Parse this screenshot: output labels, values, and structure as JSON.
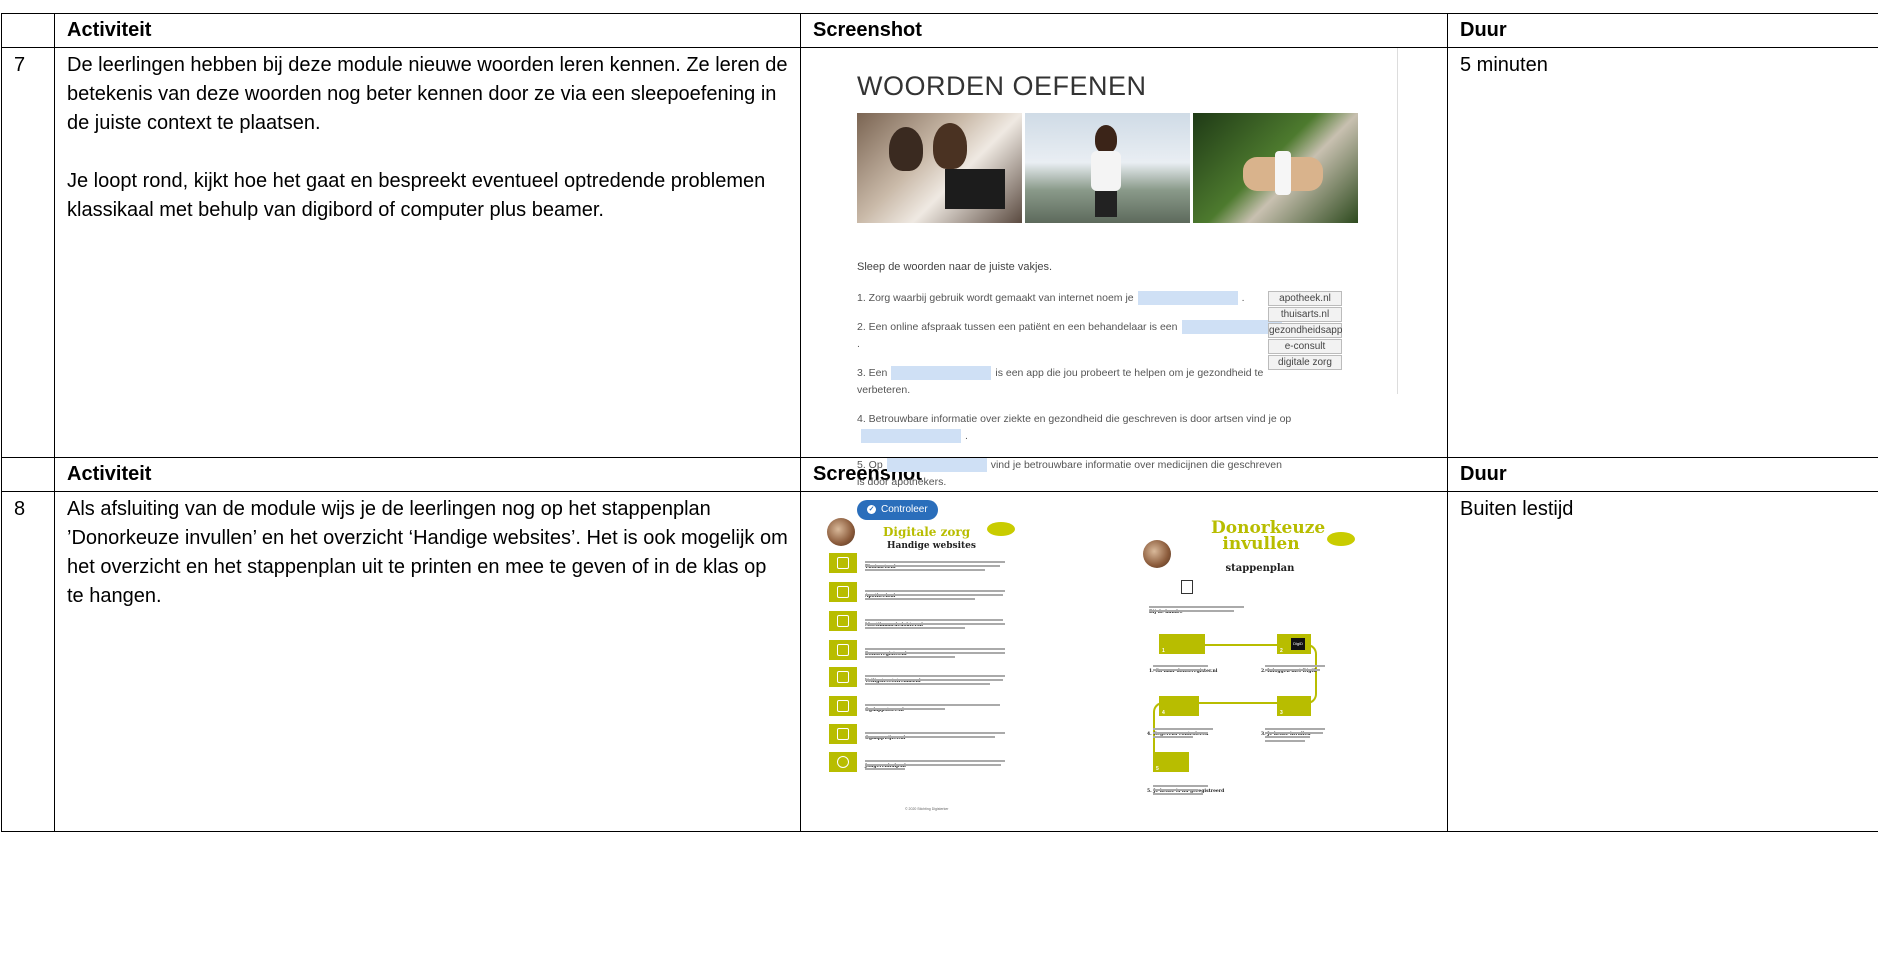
{
  "headers": {
    "activity": "Activiteit",
    "screenshot": "Screenshot",
    "duration": "Duur"
  },
  "rows": [
    {
      "number": "7",
      "paragraphs": [
        "De leerlingen hebben bij deze module nieuwe woorden leren kennen. Ze leren de betekenis van deze woorden nog beter kennen door ze via een sleepoefening in de juiste context te plaatsen.",
        "Je loopt rond, kijkt hoe het gaat en bespreekt eventueel optredende problemen klassikaal met behulp van digibord of computer plus beamer."
      ],
      "duration": "5 minuten"
    },
    {
      "number": "8",
      "paragraphs": [
        "Als afsluiting van de module wijs je de leerlingen nog op het stappenplan ’Donorkeuze invullen’ en het overzicht ‘Handige websites’. Het is ook mogelijk om het overzicht en het stappenplan uit te printen en mee te geven of in de klas op te hangen."
      ],
      "duration": "Buiten lestijd"
    }
  ],
  "exercise": {
    "title": "WOORDEN OEFENEN",
    "instruction": "Sleep de woorden naar de juiste vakjes.",
    "q1a": "1. Zorg waarbij gebruik wordt gemaakt van internet noem je",
    "q1b": ".",
    "q2a": "2. Een online afspraak tussen een patiënt en een behandelaar is een",
    "q2b": ".",
    "q3a": "3. Een",
    "q3b": "is een app die jou probeert te helpen om je gezondheid te verbeteren.",
    "q4a": "4. Betrouwbare informatie over ziekte en gezondheid die geschreven is door artsen vind je op",
    "q4b": ".",
    "q5a": "5. Op",
    "q5b": "vind je betrouwbare informatie over medicijnen die geschreven is door apothekers.",
    "options": [
      "apotheek.nl",
      "thuisarts.nl",
      "gezondheidsapp",
      "e-consult",
      "digitale zorg"
    ],
    "check_button": "Controleer",
    "check_icon": "check-circle-icon"
  },
  "poster_websites": {
    "title": "Digitale zorg",
    "subtitle": "Handige websites",
    "items": [
      "Thuisarts.nl",
      "Apotheek.nl",
      "Moetiknaardedokter.nl",
      "Donorregister.nl",
      "Veiligstreetstreams.nl",
      "Ogdappstore.nl",
      "Ogaappwijzer.nl",
      "Jongerenhulp.nl"
    ],
    "footer": "© 2020 Stichting Digisterker"
  },
  "poster_donor": {
    "title": "Donorkeuze invullen",
    "subtitle": "stappenplan",
    "intro": "Bij de hand...",
    "steps": [
      "1. Ga naar donorregister.nl",
      "2. Inloggen met DigiD",
      "3. Je keuze invullen",
      "4. Gegevens controleren",
      "5. Je keuze is nu geregistreerd"
    ],
    "digid": "DigiD"
  }
}
